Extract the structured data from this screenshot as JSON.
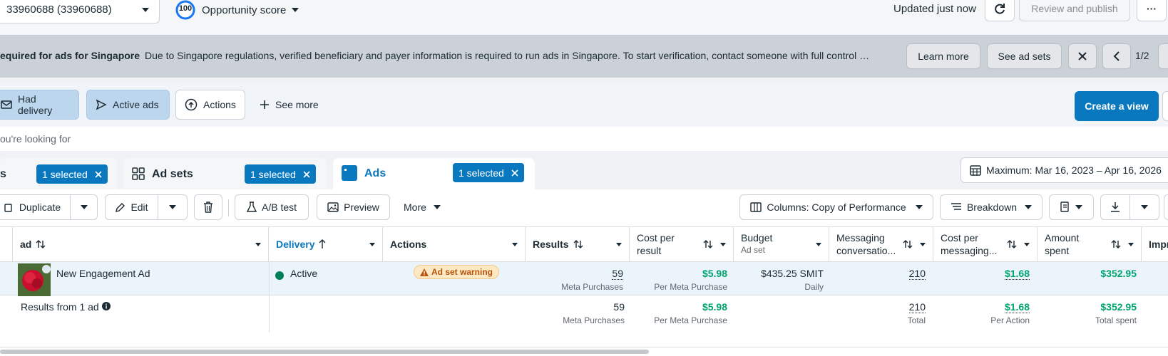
{
  "topbar": {
    "account_label": "33960688 (33960688)",
    "score_value": "100",
    "score_label": "Opportunity score",
    "updated": "Updated just now",
    "review_publish": "Review and publish",
    "more": "···"
  },
  "banner": {
    "title": "equired for ads for Singapore",
    "message": "Due to Singapore regulations, verified beneficiary and payer information is required to run ads in Singapore. To start verification, contact someone with full control …",
    "learn_more": "Learn more",
    "see_ad_sets": "See ad sets",
    "pager": "1/2"
  },
  "filters": {
    "had_delivery": "Had delivery",
    "active_ads": "Active ads",
    "actions": "Actions",
    "see_more": "See more",
    "create_view": "Create a view"
  },
  "search": {
    "placeholder": "ou're looking for"
  },
  "tabs": {
    "campaigns_tail": "s",
    "campaigns_selected": "1 selected",
    "adsets_label": "Ad sets",
    "adsets_selected": "1 selected",
    "ads_label": "Ads",
    "ads_selected": "1 selected",
    "date_range": "Maximum: Mar 16, 2023 – Apr 16, 2026"
  },
  "toolbar": {
    "duplicate": "Duplicate",
    "edit": "Edit",
    "ab_test": "A/B test",
    "preview": "Preview",
    "more": "More",
    "columns": "Columns: Copy of Performance",
    "breakdown": "Breakdown"
  },
  "table": {
    "headers": {
      "ad": "ad",
      "delivery": "Delivery",
      "actions": "Actions",
      "results": "Results",
      "cost_per_result_1": "Cost per",
      "cost_per_result_2": "result",
      "budget": "Budget",
      "budget_sub": "Ad set",
      "messaging_1": "Messaging",
      "messaging_2": "conversatio...",
      "cpm_1": "Cost per",
      "cpm_2": "messaging...",
      "amount_1": "Amount",
      "amount_2": "spent",
      "impr": "Impr"
    },
    "row": {
      "name": "New Engagement Ad",
      "delivery": "Active",
      "warning": "Ad set warning",
      "results": "59",
      "results_sub": "Meta Purchases",
      "cost": "$5.98",
      "cost_sub": "Per Meta Purchase",
      "budget": "$435.25 SMIT",
      "budget_sub": "Daily",
      "messaging": "210",
      "cpm": "$1.68",
      "amount": "$352.95"
    },
    "summary": {
      "label": "Results from 1 ad",
      "results": "59",
      "results_sub": "Meta Purchases",
      "cost": "$5.98",
      "cost_sub": "Per Meta Purchase",
      "messaging": "210",
      "messaging_sub": "Total",
      "cpm": "$1.68",
      "cpm_sub": "Per Action",
      "amount": "$352.95",
      "amount_sub": "Total spent"
    }
  },
  "colors": {
    "accent": "#0a78be",
    "active_green": "#00a36c",
    "warning_bg": "#fde8c4",
    "warning_text": "#b45309"
  }
}
